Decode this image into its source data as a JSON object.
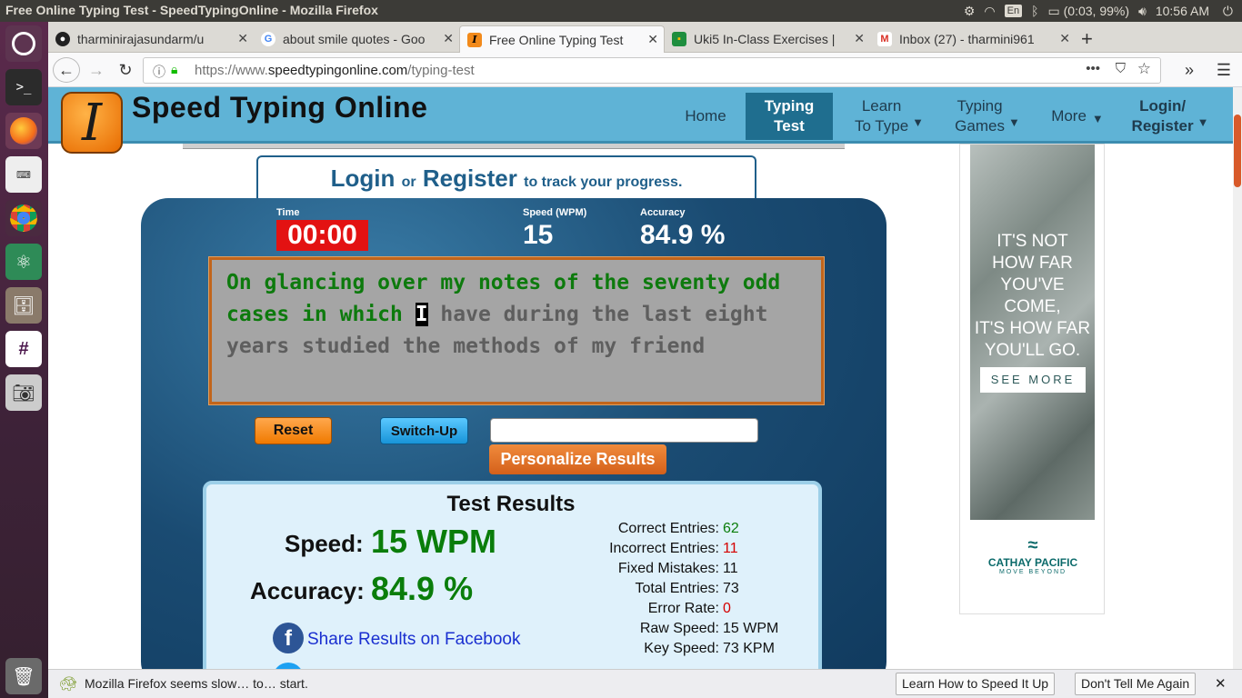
{
  "os": {
    "window_title": "Free Online Typing Test - SpeedTypingOnline - Mozilla Firefox",
    "lang": "En",
    "battery": "(0:03, 99%)",
    "clock": "10:56 AM"
  },
  "tabs": [
    {
      "label": "tharminirajasundarm/u",
      "icon": "github-icon"
    },
    {
      "label": "about smile quotes - Goo",
      "icon": "google-icon"
    },
    {
      "label": "Free Online Typing Test",
      "icon": "speedtyping-icon"
    },
    {
      "label": "Uki5 In-Class Exercises |",
      "icon": "classroom-icon"
    },
    {
      "label": "Inbox (27) - tharmini961",
      "icon": "gmail-icon"
    }
  ],
  "url": {
    "prefix": "https://www.",
    "domain": "speedtypingonline.com",
    "path": "/typing-test"
  },
  "site": {
    "name": "Speed Typing Online",
    "logo_letter": "I",
    "nav": {
      "home": "Home",
      "typing_test_1": "Typing",
      "typing_test_2": "Test",
      "learn_1": "Learn",
      "learn_2": "To Type",
      "games_1": "Typing",
      "games_2": "Games",
      "more": "More",
      "login_1": "Login/",
      "login_2": "Register",
      "arrow": "▼"
    },
    "login_prompt": {
      "login": "Login",
      "or": "or",
      "register": "Register",
      "suffix": "to track your progress."
    }
  },
  "test": {
    "time_label": "Time",
    "time_value": "00:00",
    "speed_label": "Speed (WPM)",
    "speed_value": "15",
    "accuracy_label": "Accuracy",
    "accuracy_value": "84.9 %",
    "typed_text": "On glancing over my notes of the seventy odd cases in which ",
    "cursor_char": "I",
    "remaining_text": " have during the last eight years studied the methods of my friend",
    "reset": "Reset",
    "switch_up": "Switch-Up",
    "personalize": "Personalize Results"
  },
  "results": {
    "title": "Test Results",
    "speed_label": "Speed:",
    "speed_value": "15 WPM",
    "accuracy_label": "Accuracy:",
    "accuracy_value": "84.9 %",
    "share": "Share Results on Facebook",
    "stats": [
      {
        "label": "Correct Entries:",
        "value": "62",
        "color": "#0a7d0a"
      },
      {
        "label": "Incorrect Entries:",
        "value": "11",
        "color": "#d40000"
      },
      {
        "label": "Fixed Mistakes:",
        "value": "11",
        "color": "#111111"
      },
      {
        "label": "Total Entries:",
        "value": "73",
        "color": "#111111"
      },
      {
        "label": "Error Rate:",
        "value": "0",
        "color": "#d40000"
      },
      {
        "label": "Raw Speed:",
        "value": "15 WPM",
        "color": "#111111"
      },
      {
        "label": "Key Speed:",
        "value": "73 KPM",
        "color": "#111111"
      }
    ]
  },
  "ad": {
    "line1": "IT'S NOT",
    "line2": "HOW FAR",
    "line3": "YOU'VE COME,",
    "line4": "IT'S HOW FAR",
    "line5": "YOU'LL GO.",
    "button": "SEE MORE",
    "brand": "CATHAY PACIFIC",
    "tagline": "MOVE BEYOND"
  },
  "notification": {
    "message": "Mozilla Firefox seems slow… to… start.",
    "learn": "Learn How to Speed It Up",
    "dismiss": "Don't Tell Me Again"
  }
}
